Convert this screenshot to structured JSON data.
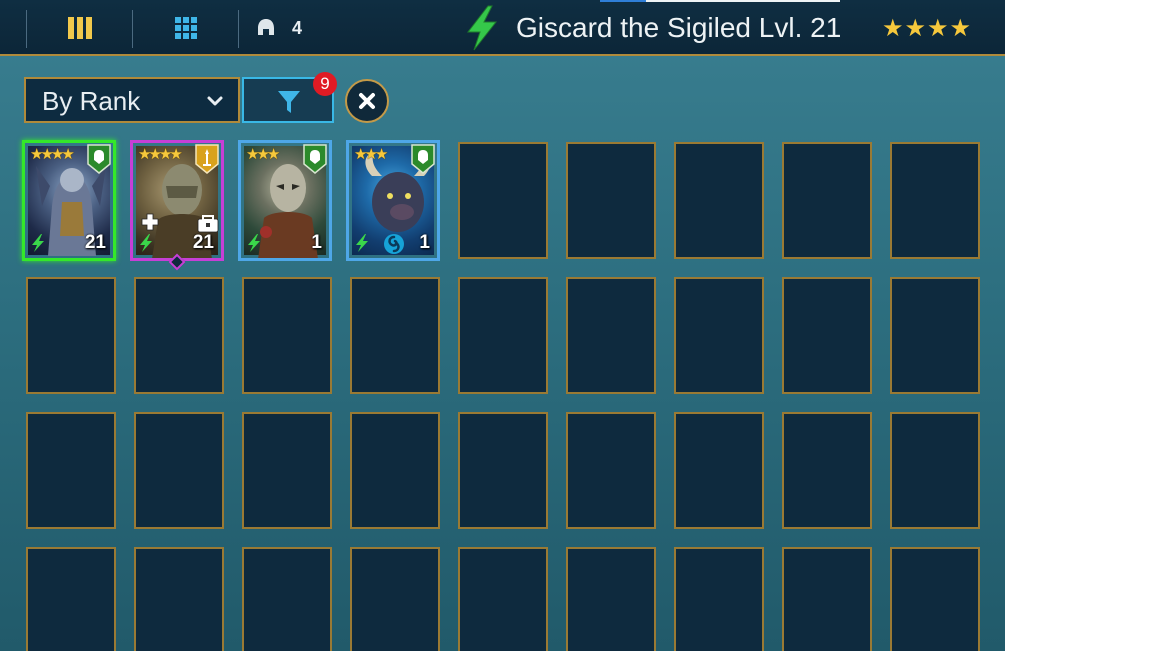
{
  "topbar": {
    "count": "4",
    "title": "Giscard the Sigiled Lvl. 21",
    "stars": "★★★★"
  },
  "controls": {
    "sort_label": "By Rank",
    "filter_badge": "9"
  },
  "heroes": [
    {
      "stars": "★★★★",
      "level": "21",
      "rarity_color": "#34e82a",
      "role": "defense"
    },
    {
      "stars": "★★★★",
      "level": "21",
      "rarity_color": "#c63fd6",
      "role": "attack"
    },
    {
      "stars": "★★★",
      "level": "1",
      "rarity_color": "#4ea7e8",
      "role": "defense"
    },
    {
      "stars": "★★★",
      "level": "1",
      "rarity_color": "#4ea7e8",
      "role": "defense"
    }
  ],
  "colors": {
    "accent_gold": "#b08a3a",
    "filter_border": "#39b8e6",
    "badge_red": "#e01b24",
    "star_yellow": "#f6c83c",
    "energy_green": "#3ad64a"
  }
}
